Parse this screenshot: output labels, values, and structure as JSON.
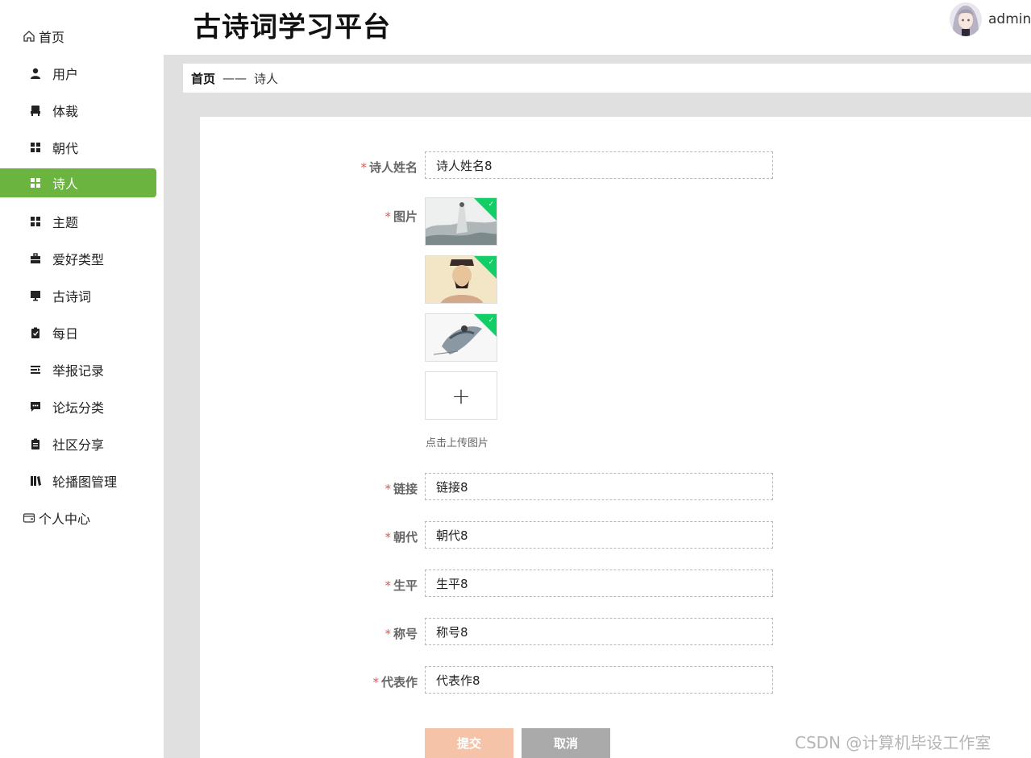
{
  "app": {
    "title": "古诗词学习平台",
    "username": "admin"
  },
  "sidebar": {
    "home": "首页",
    "items": [
      {
        "label": "用户",
        "icon": "user-icon"
      },
      {
        "label": "体裁",
        "icon": "chair-icon"
      },
      {
        "label": "朝代",
        "icon": "grid-icon"
      },
      {
        "label": "诗人",
        "icon": "grid-icon",
        "active": true
      },
      {
        "label": "主题",
        "icon": "grid-icon"
      },
      {
        "label": "爱好类型",
        "icon": "briefcase-icon"
      },
      {
        "label": "古诗词",
        "icon": "monitor-icon"
      },
      {
        "label": "每日",
        "icon": "clipboard-check-icon"
      },
      {
        "label": "举报记录",
        "icon": "list-icon"
      },
      {
        "label": "论坛分类",
        "icon": "chat-icon"
      },
      {
        "label": "社区分享",
        "icon": "clipboard-icon"
      },
      {
        "label": "轮播图管理",
        "icon": "books-icon"
      }
    ],
    "profile": "个人中心"
  },
  "breadcrumb": {
    "home": "首页",
    "separator": "——",
    "current": "诗人"
  },
  "form": {
    "name": {
      "label": "诗人姓名",
      "value": "诗人姓名8"
    },
    "image": {
      "label": "图片",
      "upload_hint": "点击上传图片",
      "plus": "+"
    },
    "link": {
      "label": "链接",
      "value": "链接8"
    },
    "dynasty": {
      "label": "朝代",
      "value": "朝代8"
    },
    "biography": {
      "label": "生平",
      "value": "生平8"
    },
    "title": {
      "label": "称号",
      "value": "称号8"
    },
    "masterpiece": {
      "label": "代表作",
      "value": "代表作8"
    },
    "required_mark": "*",
    "submit": "提交",
    "cancel": "取消"
  },
  "watermark": "CSDN @计算机毕设工作室",
  "colors": {
    "accent": "#6ab43f",
    "submit": "#f5c4a8",
    "cancel": "#aaaaaa",
    "required": "#e5574f",
    "upload_success": "#13ce66"
  }
}
